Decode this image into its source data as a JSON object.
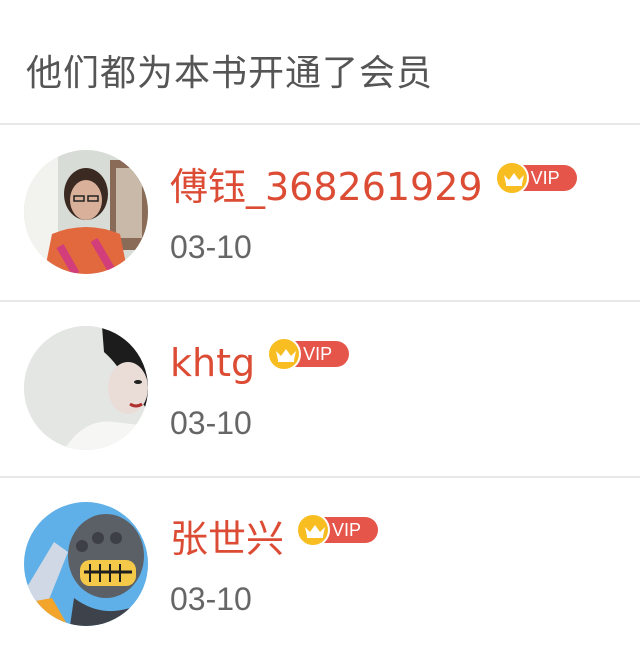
{
  "header": {
    "title": "他们都为本书开通了会员"
  },
  "members": [
    {
      "name": "傅钰_368261929",
      "vip": "VIP",
      "date": "03-10",
      "avatar_icon": "girl-photo-avatar"
    },
    {
      "name": "khtg",
      "vip": "VIP",
      "date": "03-10",
      "avatar_icon": "woman-photo-avatar"
    },
    {
      "name": "张世兴",
      "vip": "VIP",
      "date": "03-10",
      "avatar_icon": "cartoon-knight-avatar"
    }
  ],
  "colors": {
    "name": "#dc4b34",
    "vip_pill": "#e5554a",
    "crown": "#f7bd21",
    "date": "#666666",
    "title": "#555555",
    "divider": "#e8e8e8"
  }
}
